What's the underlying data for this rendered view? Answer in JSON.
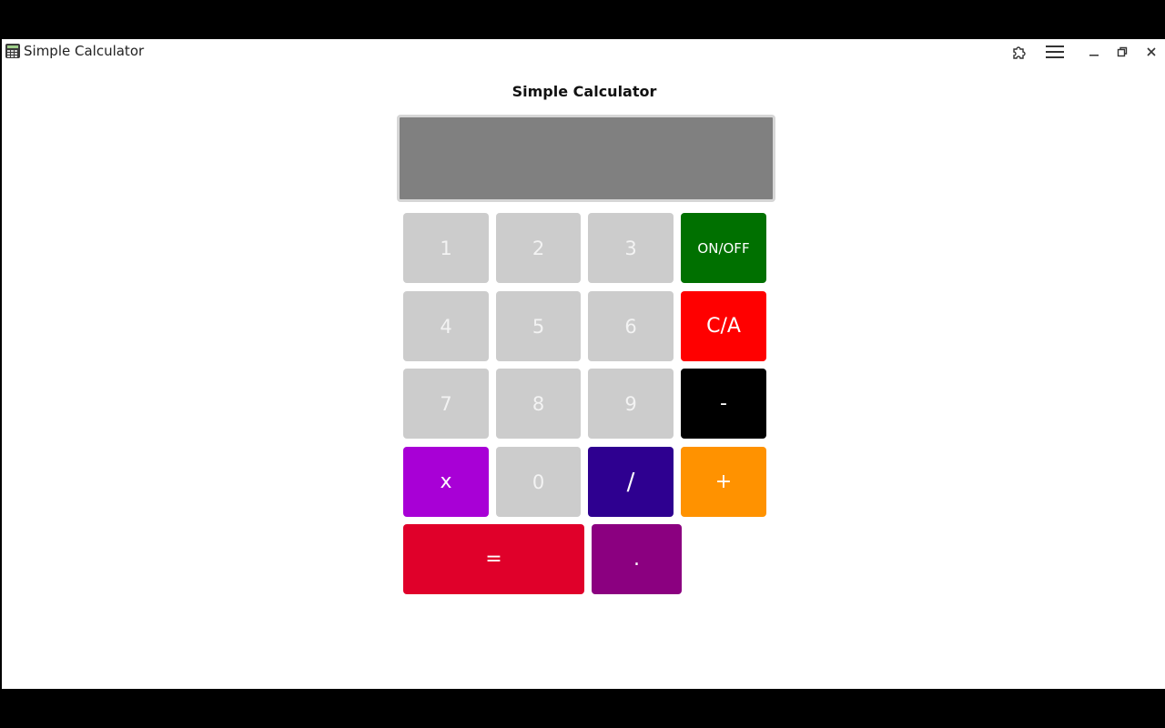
{
  "window": {
    "title": "Simple Calculator",
    "icons": [
      "extension-icon",
      "menu-icon",
      "minimize-icon",
      "restore-icon",
      "close-icon"
    ]
  },
  "heading": "Simple Calculator",
  "display": {
    "value": "",
    "color": "#808080"
  },
  "buttons": {
    "b1": "1",
    "b2": "2",
    "b3": "3",
    "onoff": "ON/OFF",
    "b4": "4",
    "b5": "5",
    "b6": "6",
    "clear": "C/A",
    "b7": "7",
    "b8": "8",
    "b9": "9",
    "minus": "-",
    "multiply": "x",
    "b0": "0",
    "divide": "/",
    "plus": "+",
    "equals": "=",
    "decimal": "."
  },
  "colors": {
    "number": "#cccccc",
    "onoff": "#007000",
    "clear": "#ff0000",
    "minus": "#000000",
    "multiply": "#a800d6",
    "divide": "#2e0090",
    "plus": "#ff9200",
    "equals": "#e0002a",
    "decimal": "#8b0080"
  }
}
